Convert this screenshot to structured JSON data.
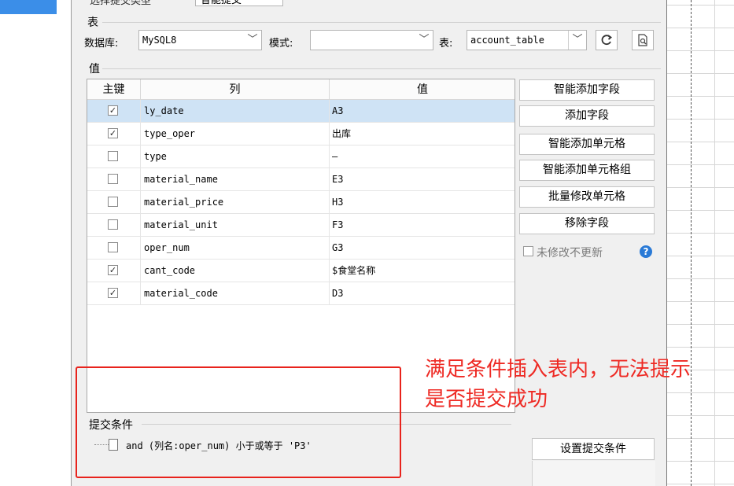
{
  "top": {
    "cut_label": "选择提交类型",
    "cut_value": "智能提交"
  },
  "table_group": {
    "title": "表",
    "db_label": "数据库:",
    "db_value": "MySQL8",
    "mode_label": "模式:",
    "mode_value": "",
    "table_label": "表:",
    "table_value": "account_table",
    "refresh_icon": "refresh-icon",
    "preview_icon": "preview-icon"
  },
  "value_group": {
    "title": "值"
  },
  "columns": {
    "key": "主键",
    "col": "列",
    "val": "值"
  },
  "rows": [
    {
      "key": true,
      "col": "ly_date",
      "val": "A3"
    },
    {
      "key": true,
      "col": "type_oper",
      "val": "出库"
    },
    {
      "key": false,
      "col": "type",
      "val": "–"
    },
    {
      "key": false,
      "col": "material_name",
      "val": "E3"
    },
    {
      "key": false,
      "col": "material_price",
      "val": "H3"
    },
    {
      "key": false,
      "col": "material_unit",
      "val": "F3"
    },
    {
      "key": false,
      "col": "oper_num",
      "val": "G3"
    },
    {
      "key": true,
      "col": "cant_code",
      "val": "$食堂名称"
    },
    {
      "key": true,
      "col": "material_code",
      "val": "D3"
    }
  ],
  "buttons": {
    "smart_add_field": "智能添加字段",
    "add_field": "添加字段",
    "smart_add_cell": "智能添加单元格",
    "smart_add_cell_group": "智能添加单元格组",
    "batch_edit_cell": "批量修改单元格",
    "remove_field": "移除字段",
    "no_update_unmodified": "未修改不更新",
    "help_icon": "?"
  },
  "conditions": {
    "title": "提交条件",
    "item": "and (列名:oper_num) 小于或等于 'P3'",
    "set_button": "设置提交条件"
  },
  "annotation": {
    "line1": "满足条件插入表内，无法提示",
    "line2": "是否提交成功",
    "color": "#ee2a24"
  }
}
